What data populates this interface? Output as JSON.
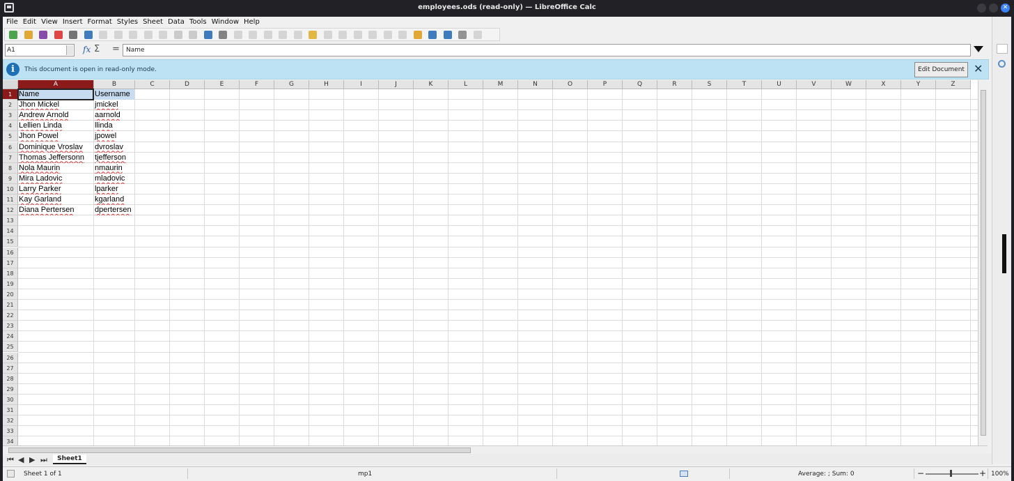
{
  "window": {
    "title": "employees.ods (read-only) — LibreOffice Calc",
    "close_glyph": "✕"
  },
  "menu": [
    "File",
    "Edit",
    "View",
    "Insert",
    "Format",
    "Styles",
    "Sheet",
    "Data",
    "Tools",
    "Window",
    "Help"
  ],
  "formula_bar": {
    "name_box": "A1",
    "fx_symbol": "fx",
    "sigma_symbol": "Σ",
    "equal_symbol": "=",
    "content": "Name"
  },
  "infobar": {
    "icon": "i",
    "message": "This document is open in read-only mode.",
    "edit_button": "Edit Document",
    "close_glyph": "✕"
  },
  "columns": [
    "A",
    "B",
    "C",
    "D",
    "E",
    "F",
    "G",
    "H",
    "I",
    "J",
    "K",
    "L",
    "M",
    "N",
    "O",
    "P",
    "Q",
    "R",
    "S",
    "T",
    "U",
    "V",
    "W",
    "X",
    "Y",
    "Z"
  ],
  "row_numbers": [
    "1",
    "2",
    "3",
    "4",
    "5",
    "6",
    "7",
    "8",
    "9",
    "10",
    "11",
    "12",
    "13",
    "14",
    "15",
    "16",
    "17",
    "18",
    "19",
    "20",
    "21",
    "22",
    "23",
    "24",
    "25",
    "26",
    "27",
    "28",
    "29",
    "30",
    "31",
    "32",
    "33",
    "34"
  ],
  "cells": [
    [
      "Name",
      "Username"
    ],
    [
      "Jhon Mickel",
      "jmickel"
    ],
    [
      "Andrew Arnold",
      "aarnold"
    ],
    [
      "Lellien Linda",
      "llinda"
    ],
    [
      "Jhon Powel",
      "jpowel"
    ],
    [
      "Dominique Vroslav",
      "dvroslav"
    ],
    [
      "Thomas Jeffersonn",
      "tjefferson"
    ],
    [
      "Nola Maurin",
      "nmaurin"
    ],
    [
      "Mira Ladovic",
      "mladovic"
    ],
    [
      "Larry Parker",
      "lparker"
    ],
    [
      "Kay Garland",
      "kgarland"
    ],
    [
      "Diana Pertersen",
      "dpertersen"
    ]
  ],
  "sheet_tab": "Sheet1",
  "status": {
    "sheet_position": "Sheet 1 of 1",
    "page_style": "mp1",
    "aggregate": "Average: ; Sum: 0",
    "zoom": "100%"
  }
}
